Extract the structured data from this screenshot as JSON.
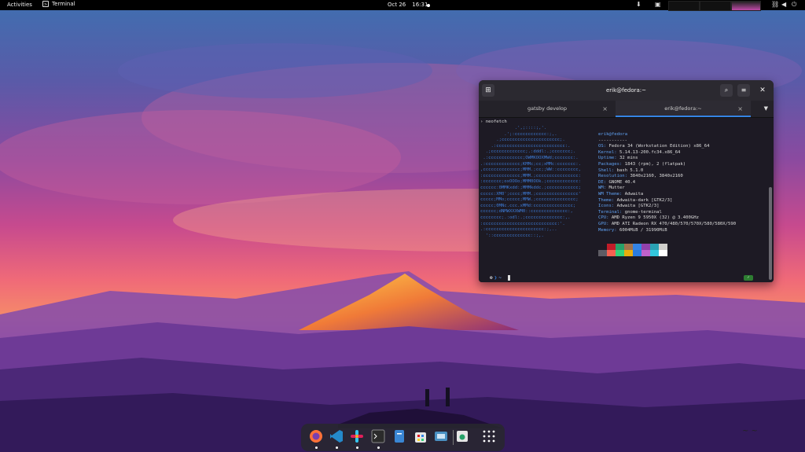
{
  "topbar": {
    "activities": "Activities",
    "app_name": "Terminal",
    "date": "Oct 26",
    "time": "16:31"
  },
  "terminal": {
    "title": "erik@fedora:~",
    "tabs": [
      {
        "label": "gatsby develop"
      },
      {
        "label": "erik@fedora:~"
      }
    ],
    "command": "neofetch",
    "logo_lines": [
      "             .',;::::;,'.",
      "         .';:cccccccccccc:;,.",
      "      .;cccccccccccccccccccccc;.",
      "    .:cccccccccccccccccccccccccc:.",
      "  .;ccccccccccccc;.:dddl:.;ccccccc;.",
      " .:ccccccccccccc;OWMKOOXMWd;ccccccc:.",
      ".:ccccccccccccc;KMMc;cc;xMMc:ccccccc:.",
      ",cccccccccccccc;MMM.;cc;;WW::cccccccc,",
      ":cccccccccccccc;MMM.;cccccccccccccccc:",
      ":ccccccc;oxOOOo;MMM0OOk.;cccccccccccc:",
      "cccccc:0MMKxdd:;MMMkddc.;cccccccccccc;",
      "ccccc:XM0';cccc;MMM.;cccccccccccccccc'",
      "ccccc;MMo;ccccc;MMW.;ccccccccccccccc;",
      "ccccc;0MNc.ccc.xMMd:ccccccccccccccc;",
      "cccccc;dNMWXXXWM0::cccccccccccccc:,",
      "cccccccc;.:odl:.;cccccccccccccc:,.",
      ":cccccccccccccccccccccccccccc:'.",
      ".:cccccccccccccccccccccc:;,..",
      "  '::cccccccccccccc::;,."
    ],
    "user": "erik",
    "host": "fedora",
    "separator": "-----------",
    "info": [
      {
        "label": "OS",
        "value": "Fedora 34 (Workstation Edition) x86_64"
      },
      {
        "label": "Kernel",
        "value": "5.14.13-200.fc34.x86_64"
      },
      {
        "label": "Uptime",
        "value": "32 mins"
      },
      {
        "label": "Packages",
        "value": "1843 (rpm), 2 (flatpak)"
      },
      {
        "label": "Shell",
        "value": "bash 5.1.0"
      },
      {
        "label": "Resolution",
        "value": "3840x2160, 3840x2160"
      },
      {
        "label": "DE",
        "value": "GNOME 40.4"
      },
      {
        "label": "WM",
        "value": "Mutter"
      },
      {
        "label": "WM Theme",
        "value": "Adwaita"
      },
      {
        "label": "Theme",
        "value": "Adwaita-dark [GTK2/3]"
      },
      {
        "label": "Icons",
        "value": "Adwaita [GTK2/3]"
      },
      {
        "label": "Terminal",
        "value": "gnome-terminal"
      },
      {
        "label": "CPU",
        "value": "AMD Ryzen 9 5950X (32) @ 3.400GHz"
      },
      {
        "label": "GPU",
        "value": "AMD ATI Radeon RX 470/480/570/570X/580/580X/590"
      },
      {
        "label": "Memory",
        "value": "6004MiB / 31990MiB"
      }
    ],
    "palette_top": [
      "#1d1a24",
      "#c01c28",
      "#26a269",
      "#a2734c",
      "#3584e4",
      "#9141ac",
      "#2aa1b3",
      "#d0cfcc"
    ],
    "palette_bottom": [
      "#5e5c64",
      "#f66151",
      "#33d17a",
      "#e9ad0c",
      "#2a7bde",
      "#c061cb",
      "#33c7de",
      "#ffffff"
    ],
    "prompt_symbol": "~"
  },
  "dock": {
    "items": [
      {
        "icon": "firefox-icon",
        "color": "#ff7139",
        "running": true
      },
      {
        "icon": "vscode-icon",
        "color": "#2489ca",
        "running": true
      },
      {
        "icon": "slack-icon",
        "color": "#e01e5a",
        "running": true
      },
      {
        "icon": "terminal-icon",
        "color": "#2b2b2b",
        "running": true
      },
      {
        "icon": "files-icon",
        "color": "#3a86d4",
        "running": false
      },
      {
        "icon": "software-icon",
        "color": "#e6e6e6",
        "running": false
      },
      {
        "icon": "screenshot-icon",
        "color": "#4a90c2",
        "running": false
      },
      {
        "icon": "recycle-icon",
        "color": "#e6e6e6",
        "running": false
      },
      {
        "icon": "app-grid-icon",
        "color": "#ffffff",
        "running": false
      }
    ]
  }
}
